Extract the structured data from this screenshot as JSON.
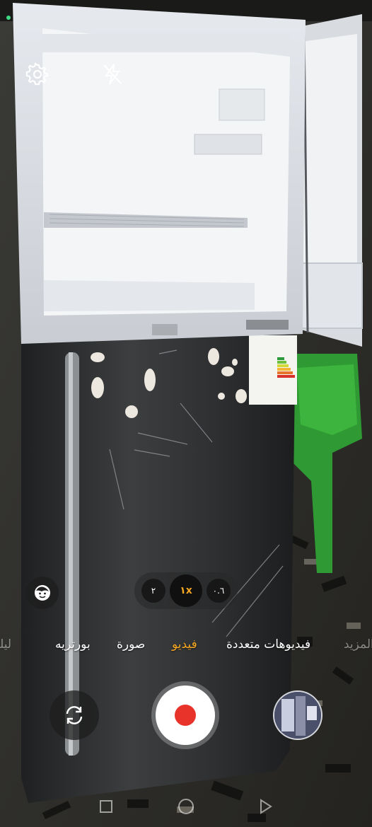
{
  "status": {
    "indicator_color": "#3ddc84"
  },
  "camera": {
    "settings_icon": "gear-icon",
    "flash_icon": "flash-off-icon",
    "filter_icon": "face-filter-icon",
    "zoom": {
      "left": "٢",
      "active": "١x",
      "right": "٠.٦"
    },
    "modes": {
      "edge_left": "ليلي",
      "portrait": "بورتريه",
      "photo": "صورة",
      "video": "فيديو",
      "multi_video": "فيديوهات متعددة",
      "edge_right": "المزيد"
    },
    "active_mode_color": "#f5a623",
    "record_color": "#e8332b",
    "switch_camera_icon": "switch-camera-icon",
    "gallery_thumbnail": "gallery-thumbnail"
  },
  "navbar": {
    "recents_icon": "recents-icon",
    "home_icon": "home-icon",
    "back_icon": "back-icon"
  }
}
